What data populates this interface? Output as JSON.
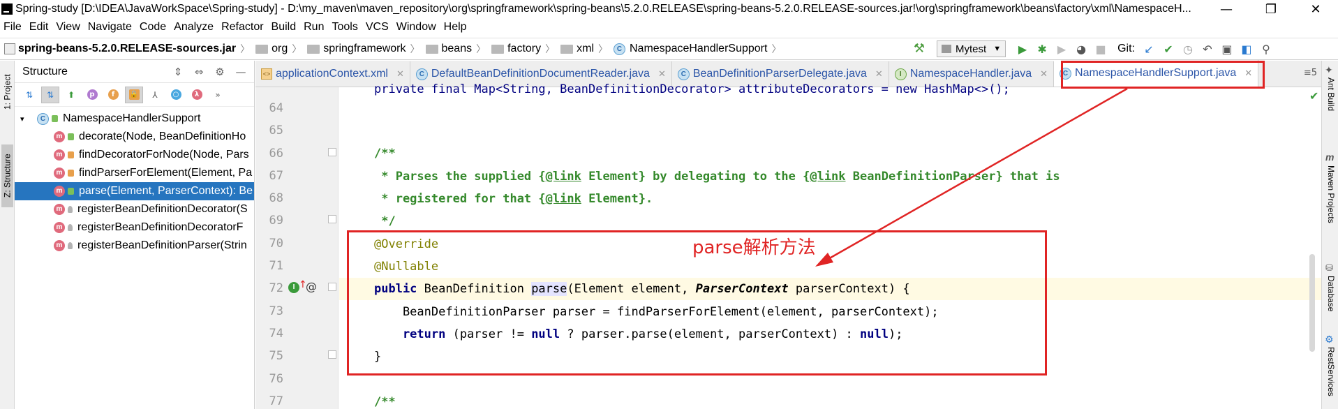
{
  "window": {
    "title": "Spring-study [D:\\IDEA\\JavaWorkSpace\\Spring-study] - D:\\my_maven\\maven_repository\\org\\springframework\\spring-beans\\5.2.0.RELEASE\\spring-beans-5.2.0.RELEASE-sources.jar!\\org\\springframework\\beans\\factory\\xml\\NamespaceH...",
    "minimize": "—",
    "maximize": "❐",
    "close": "✕"
  },
  "menu": [
    "File",
    "Edit",
    "View",
    "Navigate",
    "Code",
    "Analyze",
    "Refactor",
    "Build",
    "Run",
    "Tools",
    "VCS",
    "Window",
    "Help"
  ],
  "breadcrumb": {
    "jar": "spring-beans-5.2.0.RELEASE-sources.jar",
    "items": [
      "org",
      "springframework",
      "beans",
      "factory",
      "xml"
    ],
    "class": "NamespaceHandlerSupport"
  },
  "toolbar": {
    "run_config": "Mytest",
    "git_label": "Git:"
  },
  "left_stripe": {
    "project": "1: Project",
    "structure": "Z: Structure"
  },
  "structure": {
    "title": "Structure",
    "root": "NamespaceHandlerSupport",
    "items": [
      {
        "label": "decorate(Node, BeanDefinitionHo",
        "vis": "public"
      },
      {
        "label": "findDecoratorForNode(Node, Pars",
        "vis": "private"
      },
      {
        "label": "findParserForElement(Element, Pa",
        "vis": "private"
      },
      {
        "label": "parse(Element, ParserContext): Be",
        "vis": "public"
      },
      {
        "label": "registerBeanDefinitionDecorator(S",
        "vis": "protected"
      },
      {
        "label": "registerBeanDefinitionDecoratorF",
        "vis": "protected"
      },
      {
        "label": "registerBeanDefinitionParser(Strin",
        "vis": "protected"
      }
    ]
  },
  "tabs": [
    {
      "label": "applicationContext.xml",
      "kind": "xml"
    },
    {
      "label": "DefaultBeanDefinitionDocumentReader.java",
      "kind": "class"
    },
    {
      "label": "BeanDefinitionParserDelegate.java",
      "kind": "class"
    },
    {
      "label": "NamespaceHandler.java",
      "kind": "interface"
    },
    {
      "label": "NamespaceHandlerSupport.java",
      "kind": "class"
    }
  ],
  "tabs_more": "≡5",
  "code": {
    "line_numbers": [
      "64",
      "65",
      "66",
      "67",
      "68",
      "69",
      "70",
      "71",
      "72",
      "73",
      "74",
      "75",
      "76",
      "77"
    ],
    "partial_top": "private final Map<String, BeanDefinitionDecorator> attributeDecorators = new HashMap<>();",
    "l66": "/**",
    "l67_a": " * Parses the supplied {",
    "l67_tag1": "@link",
    "l67_b": " Element} by delegating to the {",
    "l67_tag2": "@link",
    "l67_c": " BeanDefinitionParser} that is",
    "l68_a": " * registered for that {",
    "l68_tag": "@link",
    "l68_b": " Element}.",
    "l69": " */",
    "l70": "@Override",
    "l71": "@Nullable",
    "l72_kw": "public",
    "l72_a": " BeanDefinition ",
    "l72_name": "parse",
    "l72_b": "(Element element, ",
    "l72_type": "ParserContext",
    "l72_c": " parserContext) {",
    "l73": "    BeanDefinitionParser parser = findParserForElement(element, parserContext);",
    "l74_kw": "    return",
    "l74_a": " (parser != ",
    "l74_null1": "null",
    "l74_b": " ? parser.parse(element, parserContext) : ",
    "l74_null2": "null",
    "l74_c": ");",
    "l75": "}",
    "l77": "/**"
  },
  "annotation": {
    "text": "parse解析方法",
    "color": "#e02424"
  },
  "right_stripe": {
    "ant": "Ant Build",
    "maven": "Maven Projects",
    "database": "Database",
    "rest": "RestServices"
  }
}
